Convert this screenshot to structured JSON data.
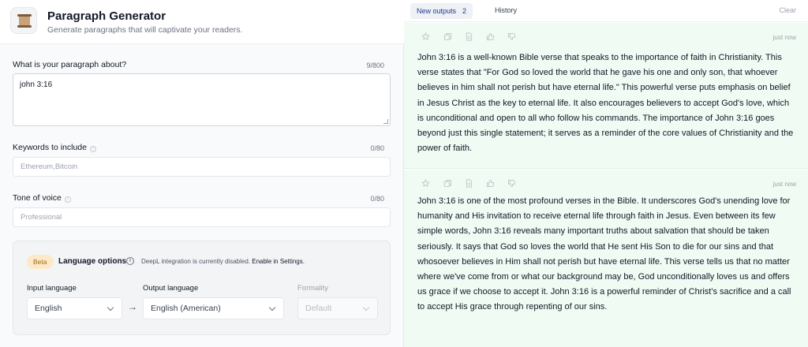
{
  "app": {
    "title": "Paragraph Generator",
    "subtitle": "Generate paragraphs that will captivate your readers.",
    "icon": "scroll-icon"
  },
  "form": {
    "about": {
      "label": "What is your paragraph about?",
      "count": "9/800",
      "value": "john 3:16"
    },
    "keywords": {
      "label": "Keywords to include",
      "count": "0/80",
      "placeholder": "Ethereum,Bitcoin",
      "info_icon": "info-icon"
    },
    "tone": {
      "label": "Tone of voice",
      "count": "0/80",
      "placeholder": "Professional",
      "info_icon": "info-icon"
    }
  },
  "language": {
    "badge": "Beta",
    "title": "Language options",
    "info_glyph": "i",
    "note": "DeepL integration is currently disabled.",
    "note_link": "Enable in Settings.",
    "input_label": "Input language",
    "input_value": "English",
    "arrow": "→",
    "output_label": "Output language",
    "output_value": "English (American)",
    "formality_label": "Formality",
    "formality_value": "Default"
  },
  "outputs": {
    "tab_label": "New outputs",
    "tab_count": "2",
    "history_label": "History",
    "clear_label": "Clear",
    "items": [
      {
        "time": "just now",
        "text": "John 3:16 is a well-known Bible verse that speaks to the importance of faith in Christianity. This verse states that \"For God so loved the world that he gave his one and only son, that whoever believes in him shall not perish but have eternal life.\" This powerful verse puts emphasis on belief in Jesus Christ as the key to eternal life. It also encourages believers to accept God's love, which is unconditional and open to all who follow his commands. The importance of John 3:16 goes beyond just this single statement; it serves as a reminder of the core values of Christianity and the power of faith."
      },
      {
        "time": "just now",
        "text": "John 3:16 is one of the most profound verses in the Bible. It underscores God's unending love for humanity and His invitation to receive eternal life through faith in Jesus. Even between its few simple words, John 3:16 reveals many important truths about salvation that should be taken seriously. It says that God so loves the world that He sent His Son to die for our sins and that whosoever believes in Him shall not perish but have eternal life. This verse tells us that no matter where we've come from or what our background may be, God unconditionally loves us and offers us grace if we choose to accept it. John 3:16 is a powerful reminder of Christ's sacrifice and a call to accept His grace through repenting of our sins."
      }
    ],
    "action_icons": [
      "star-icon",
      "copy-icon",
      "document-icon",
      "thumbs-up-icon",
      "thumbs-down-icon"
    ]
  },
  "colors": {
    "output_bg": "#f0fbf3",
    "beta_bg": "#fde9c8",
    "tab_active_bg": "#eef1f5"
  }
}
